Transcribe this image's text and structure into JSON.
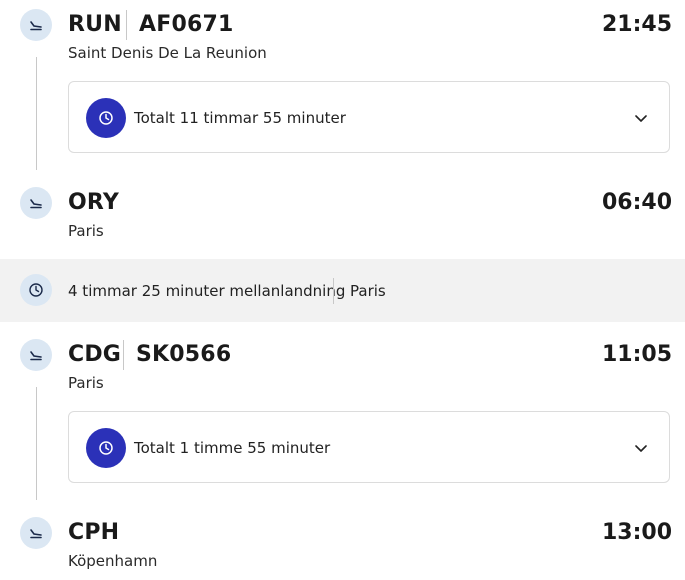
{
  "segments": [
    {
      "code": "RUN",
      "flight": "AF0671",
      "city": "Saint Denis De La Reunion",
      "time": "21:45"
    },
    {
      "code": "ORY",
      "city": "Paris",
      "time": "06:40"
    },
    {
      "code": "CDG",
      "flight": "SK0566",
      "city": "Paris",
      "time": "11:05"
    },
    {
      "code": "CPH",
      "city": "Köpenhamn",
      "time": "13:00"
    }
  ],
  "durations": [
    {
      "label": "Totalt 11 timmar 55 minuter"
    },
    {
      "label": "Totalt 1 timme 55 minuter"
    }
  ],
  "layover": {
    "label": "4 timmar 25 minuter mellanlandning",
    "city": "Paris"
  },
  "icons": {
    "segment": "plane-landing-icon",
    "duration": "clock-icon",
    "expand": "chevron-down-icon"
  },
  "colors": {
    "accent": "#2b31b8",
    "icon_bg": "#dbe7f3",
    "layover_bg": "#f2f2f2"
  }
}
